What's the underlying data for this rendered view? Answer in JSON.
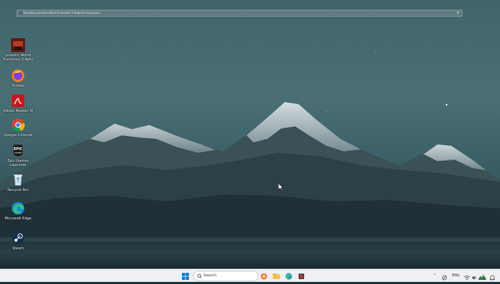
{
  "window": {
    "title": "BullyPlay Jurassic World Evolution 3 Rebirth Suspenses",
    "close_glyph": "✕"
  },
  "desktop_icons": [
    {
      "label": "Jurassic World Evolution 3 Rebi",
      "icon": "jurassic-world-icon"
    },
    {
      "label": "Firefox",
      "icon": "firefox-icon"
    },
    {
      "label": "Adobe Reader XI",
      "icon": "adobe-reader-icon"
    },
    {
      "label": "Google Chrome",
      "icon": "chrome-icon"
    },
    {
      "label": "Epic Games Launcher",
      "icon": "epic-games-icon"
    },
    {
      "label": "Recycle Bin",
      "icon": "recycle-bin-icon"
    },
    {
      "label": "Microsoft Edge",
      "icon": "edge-icon"
    },
    {
      "label": "Steam",
      "icon": "steam-icon"
    }
  ],
  "taskbar": {
    "search_placeholder": "Search",
    "pinned": [
      "browser-app-icon",
      "file-explorer-icon",
      "edge-icon",
      "game-app-icon"
    ],
    "tray": {
      "language": "ENG",
      "chevron": "^"
    }
  },
  "colors": {
    "sky_top": "#4d7379",
    "sky_bottom": "#2e4a52",
    "taskbar": "#eef0f3",
    "accent": "#0067c0"
  }
}
